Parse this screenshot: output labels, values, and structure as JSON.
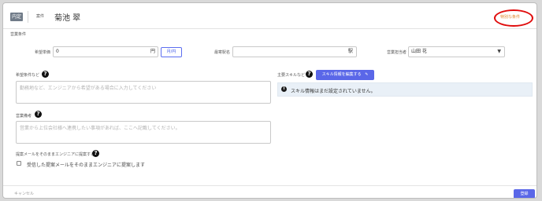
{
  "header": {
    "badge": "内定",
    "sub_label": "案件",
    "name": "菊池 翠",
    "special_condition": "特別な条件"
  },
  "section": {
    "title": "営業条件"
  },
  "fields": {
    "price": {
      "label": "希望単価",
      "value": "0",
      "unit": "円",
      "unit_button": "月/円"
    },
    "station": {
      "label": "最寄駅名",
      "suffix": "駅"
    },
    "sales_person": {
      "label": "営業担当者",
      "value": "山田 花"
    },
    "hope_conditions": {
      "label": "希望条件など",
      "placeholder": "勤務地など、エンジニアから希望がある場合に入力してください"
    },
    "skills": {
      "label": "主要スキルなど",
      "edit_button": "スキル情報を編集する",
      "empty_message": "スキル情報はまだ設定されていません。"
    },
    "sales_notes": {
      "label": "営業備考",
      "placeholder": "営業から上位会社様へ連携したい事項があれば、ここへ記載してください。"
    },
    "proposal_mail": {
      "label": "提案メールをそのままエンジニアに提案する",
      "checkbox_label": "受信した提案メールをそのままエンジニアに提案します"
    }
  },
  "footer": {
    "cancel": "キャンセル",
    "submit": "登録"
  },
  "colors": {
    "accent": "#5a67e8",
    "highlight_circle": "#e00c0c",
    "special_text": "#e2852a"
  }
}
